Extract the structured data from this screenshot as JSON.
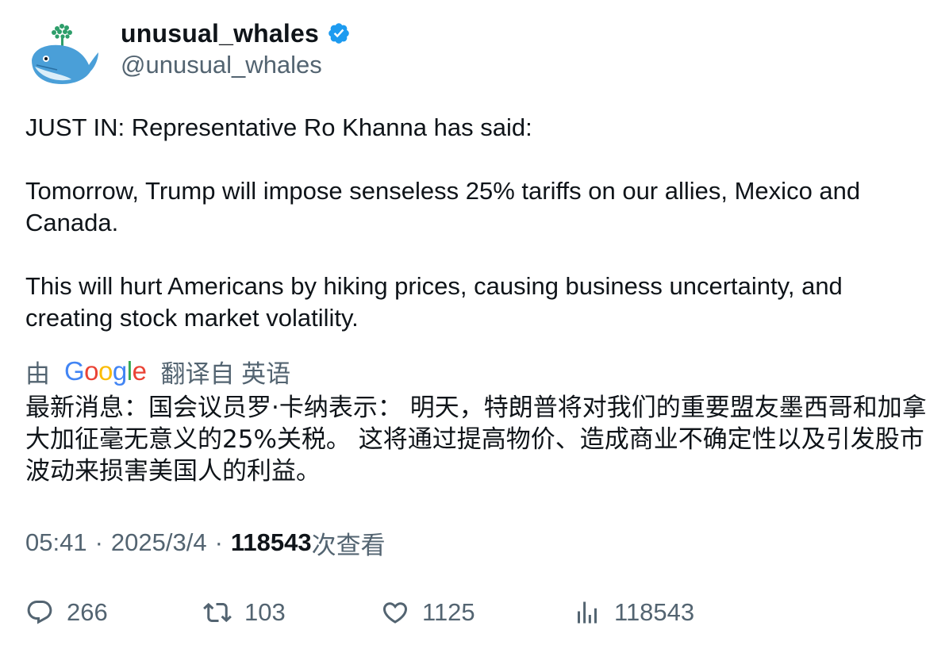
{
  "author": {
    "display_name": "unusual_whales",
    "handle": "@unusual_whales",
    "verified": true,
    "avatar_icon": "whale-logo-icon"
  },
  "tweet": {
    "paragraphs": [
      "JUST IN: Representative Ro Khanna has said:",
      "Tomorrow, Trump will impose senseless 25% tariffs on our allies, Mexico and Canada.",
      "This will hurt Americans by hiking prices, causing business uncertainty, and creating stock market volatility."
    ]
  },
  "translation": {
    "prefix": "由",
    "provider": "Google",
    "suffix": "翻译自 英语",
    "text": "最新消息：国会议员罗·卡纳表示： 明天，特朗普将对我们的重要盟友墨西哥和加拿大加征毫无意义的25%关税。 这将通过提高物价、造成商业不确定性以及引发股市波动来损害美国人的利益。"
  },
  "meta": {
    "time": "05:41",
    "separator": "·",
    "date": "2025/3/4",
    "views_count": "118543",
    "views_label": "次查看"
  },
  "actions": {
    "replies": "266",
    "reposts": "103",
    "likes": "1125",
    "views": "118543"
  },
  "colors": {
    "text_primary": "#0f1419",
    "text_secondary": "#536471",
    "verified_blue": "#1d9bf0"
  }
}
